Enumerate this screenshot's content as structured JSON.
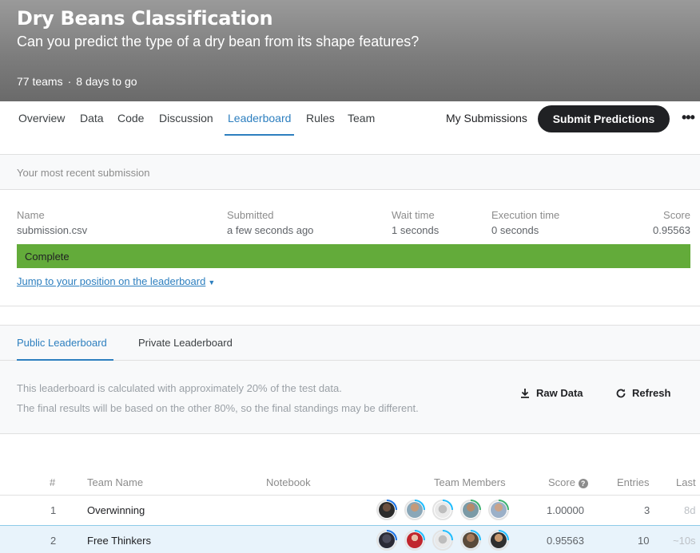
{
  "competition": {
    "title": "Dry Beans Classification",
    "subtitle": "Can you predict the type of a dry bean from its shape features?",
    "teams": "77 teams",
    "separator": "·",
    "time_left": "8 days to go"
  },
  "nav": {
    "tabs": [
      "Overview",
      "Data",
      "Code",
      "Discussion",
      "Leaderboard",
      "Rules",
      "Team"
    ],
    "active_tab": "Leaderboard",
    "my_submissions": "My Submissions",
    "submit_button": "Submit Predictions",
    "more_icon": "more-horizontal-icon"
  },
  "recent_submission": {
    "heading": "Your most recent submission",
    "name_label": "Name",
    "name_value": "submission.csv",
    "submitted_label": "Submitted",
    "submitted_value": "a few seconds ago",
    "wait_label": "Wait time",
    "wait_value": "1 seconds",
    "exec_label": "Execution time",
    "exec_value": "0 seconds",
    "score_label": "Score",
    "score_value": "0.95563",
    "status": "Complete",
    "jump_link": "Jump to your position on the leaderboard",
    "status_color": "#63ab3a"
  },
  "leaderboard": {
    "tabs": [
      "Public Leaderboard",
      "Private Leaderboard"
    ],
    "active_tab": "Public Leaderboard",
    "info_line1": "This leaderboard is calculated with approximately 20% of the test data.",
    "info_line2": "The final results will be based on the other 80%, so the final standings may be different.",
    "raw_data_button": "Raw Data",
    "refresh_button": "Refresh",
    "columns": {
      "rank": "#",
      "team_name": "Team Name",
      "notebook": "Notebook",
      "team_members": "Team Members",
      "score": "Score",
      "entries": "Entries",
      "last": "Last"
    },
    "rows": [
      {
        "rank": "1",
        "team": "Overwinning",
        "score": "1.00000",
        "entries": "3",
        "last": "8d",
        "highlighted": false
      },
      {
        "rank": "2",
        "team": "Free Thinkers",
        "score": "0.95563",
        "entries": "10",
        "last": "~10s",
        "highlighted": true
      }
    ]
  }
}
